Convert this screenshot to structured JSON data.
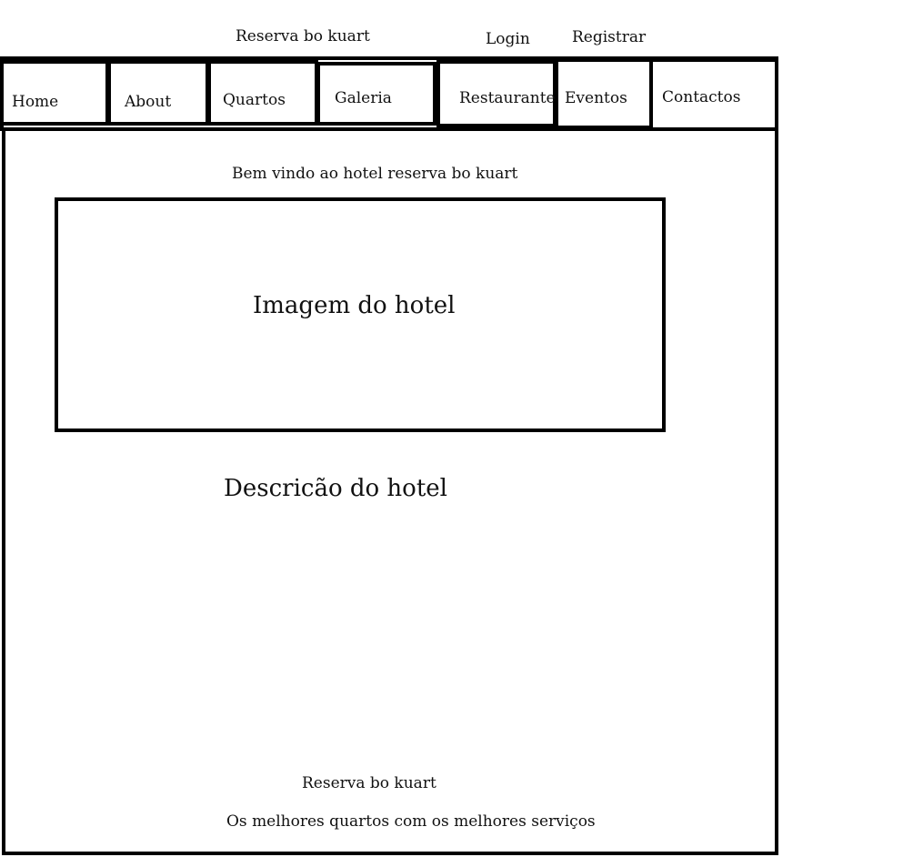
{
  "header": {
    "site_name": "Reserva bo kuart",
    "login_label": "Login",
    "register_label": "Registrar"
  },
  "nav": {
    "items": [
      {
        "label": "Home"
      },
      {
        "label": "About"
      },
      {
        "label": "Quartos"
      },
      {
        "label": "Galeria"
      },
      {
        "label": "Restaurante"
      },
      {
        "label": "Eventos"
      },
      {
        "label": "Contactos"
      }
    ]
  },
  "main": {
    "welcome_text": "Bem vindo ao hotel reserva bo kuart",
    "hero_image_label": "Imagem do hotel",
    "description_label": "Descricão do hotel"
  },
  "footer": {
    "site_name": "Reserva bo kuart",
    "tagline": "Os melhores quartos com os melhores serviços"
  }
}
